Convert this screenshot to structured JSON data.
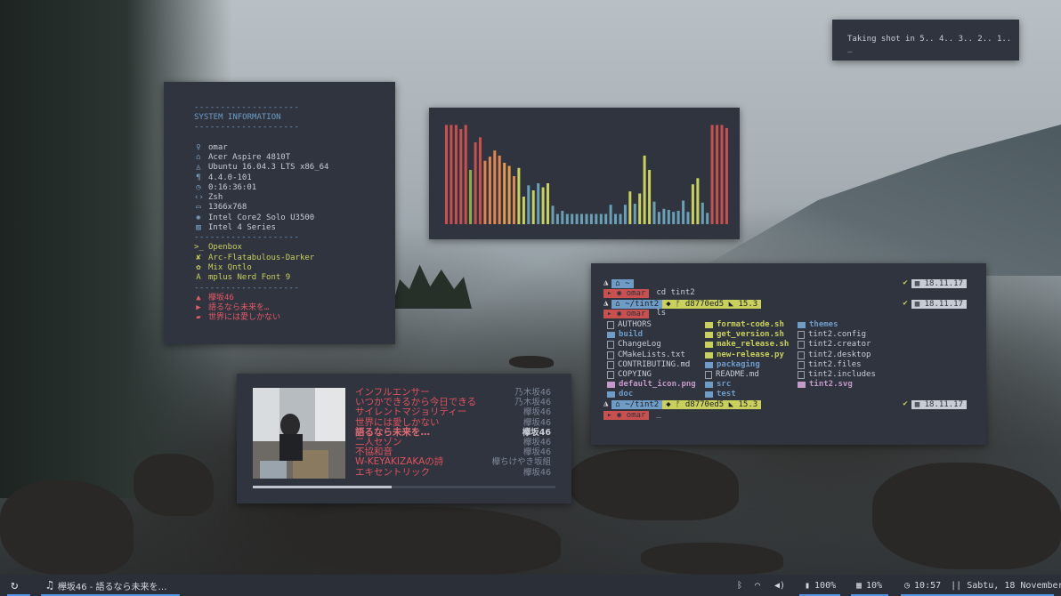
{
  "screenshot": {
    "countdown": "Taking shot in 5.. 4.. 3.. 2.. 1.. _"
  },
  "sysinfo": {
    "dash": "--------------------",
    "header": "SYSTEM INFORMATION",
    "rows": [
      {
        "icon": "user-icon",
        "glyph": "♀",
        "text": "omar"
      },
      {
        "icon": "machine-icon",
        "glyph": "⌂",
        "text": "Acer Aspire 4810T"
      },
      {
        "icon": "os-icon",
        "glyph": "◬",
        "text": "Ubuntu 16.04.3 LTS x86_64"
      },
      {
        "icon": "kernel-icon",
        "glyph": "¶",
        "text": "4.4.0-101"
      },
      {
        "icon": "uptime-icon",
        "glyph": "◷",
        "text": "0:16:36:01"
      },
      {
        "icon": "shell-icon",
        "glyph": "‹›",
        "text": "Zsh"
      },
      {
        "icon": "resolution-icon",
        "glyph": "▭",
        "text": "1366x768"
      },
      {
        "icon": "cpu-icon",
        "glyph": "✺",
        "text": "Intel Core2 Solo U3500"
      },
      {
        "icon": "gpu-icon",
        "glyph": "▨",
        "text": "Intel 4 Series"
      }
    ],
    "rows2": [
      {
        "icon": "wm-icon",
        "glyph": ">_",
        "text": "Openbox"
      },
      {
        "icon": "theme-icon",
        "glyph": "✘",
        "text": "Arc-Flatabulous-Darker"
      },
      {
        "icon": "icons-icon",
        "glyph": "✿",
        "text": "Mix Qntlo"
      },
      {
        "icon": "font-icon",
        "glyph": "A",
        "text": "mplus Nerd Font 9"
      }
    ],
    "rows3": [
      {
        "icon": "lock-icon",
        "glyph": "▲",
        "text": "欅坂46"
      },
      {
        "icon": "play-icon",
        "glyph": "▶",
        "text": "語るなら未来を…"
      },
      {
        "icon": "folder-icon",
        "glyph": "▰",
        "text": "世界には愛しかない"
      }
    ]
  },
  "visualizer": {
    "levels": [
      0.97,
      0.97,
      0.97,
      0.93,
      0.97,
      0.53,
      0.8,
      0.85,
      0.62,
      0.66,
      0.72,
      0.67,
      0.6,
      0.57,
      0.47,
      0.55,
      0.27,
      0.38,
      0.33,
      0.4,
      0.36,
      0.4,
      0.18,
      0.1,
      0.13,
      0.1,
      0.1,
      0.1,
      0.1,
      0.1,
      0.1,
      0.1,
      0.1,
      0.1,
      0.19,
      0.1,
      0.1,
      0.19,
      0.32,
      0.2,
      0.3,
      0.67,
      0.53,
      0.22,
      0.12,
      0.15,
      0.14,
      0.12,
      0.13,
      0.23,
      0.12,
      0.39,
      0.45,
      0.21,
      0.11,
      0.97,
      0.97,
      0.97,
      0.94
    ],
    "colors": [
      "#c9504f",
      "#c9504f",
      "#c9504f",
      "#c9504f",
      "#c9504f",
      "#8bb046",
      "#c9504f",
      "#c9504f",
      "#e0864e",
      "#e0864e",
      "#e0864e",
      "#e0864e",
      "#e39b52",
      "#e39b52",
      "#e0864e",
      "#c9d05c",
      "#c9d05c",
      "#6a9fb5",
      "#c9d05c",
      "#6a9fb5",
      "#c9d05c",
      "#c9d05c",
      "#6a9fb5",
      "#6a9fb5",
      "#6a9fb5",
      "#6a9fb5",
      "#6a9fb5",
      "#6a9fb5",
      "#6a9fb5",
      "#6a9fb5",
      "#6a9fb5",
      "#6a9fb5",
      "#6a9fb5",
      "#6a9fb5",
      "#6a9fb5",
      "#6a9fb5",
      "#6a9fb5",
      "#6a9fb5",
      "#c9d05c",
      "#6a9fb5",
      "#c9d05c",
      "#c9d05c",
      "#c9d05c",
      "#6a9fb5",
      "#6a9fb5",
      "#6a9fb5",
      "#6a9fb5",
      "#6a9fb5",
      "#6a9fb5",
      "#6a9fb5",
      "#6a9fb5",
      "#c9d05c",
      "#c9d05c",
      "#6a9fb5",
      "#6a9fb5",
      "#c9504f",
      "#c9504f",
      "#c9504f",
      "#c9504f"
    ]
  },
  "terminal": {
    "home_seg": "~",
    "user": "omar",
    "cmd1": "cd tint2",
    "dir": "~/tint2",
    "branch": "d8770ed5",
    "version": "15.3",
    "cmd2": "ls",
    "date": "18.11.17",
    "cursor": "_",
    "files_col1": [
      {
        "name": "AUTHORS",
        "type": "file"
      },
      {
        "name": "build",
        "type": "dir"
      },
      {
        "name": "ChangeLog",
        "type": "file"
      },
      {
        "name": "CMakeLists.txt",
        "type": "file"
      },
      {
        "name": "CONTRIBUTING.md",
        "type": "file"
      },
      {
        "name": "COPYING",
        "type": "file"
      },
      {
        "name": "default_icon.png",
        "type": "img"
      },
      {
        "name": "doc",
        "type": "dir"
      }
    ],
    "files_col2": [
      {
        "name": "format-code.sh",
        "type": "exec"
      },
      {
        "name": "get_version.sh",
        "type": "exec"
      },
      {
        "name": "make_release.sh",
        "type": "exec"
      },
      {
        "name": "new-release.py",
        "type": "exec"
      },
      {
        "name": "packaging",
        "type": "dir"
      },
      {
        "name": "README.md",
        "type": "file"
      },
      {
        "name": "src",
        "type": "dir"
      },
      {
        "name": "test",
        "type": "dir"
      }
    ],
    "files_col3": [
      {
        "name": "themes",
        "type": "dir"
      },
      {
        "name": "tint2.config",
        "type": "file"
      },
      {
        "name": "tint2.creator",
        "type": "file"
      },
      {
        "name": "tint2.desktop",
        "type": "file"
      },
      {
        "name": "tint2.files",
        "type": "file"
      },
      {
        "name": "tint2.includes",
        "type": "file"
      },
      {
        "name": "tint2.svg",
        "type": "img"
      }
    ]
  },
  "music": {
    "progress": 0.46,
    "tracks": [
      {
        "title": "インフルエンサー",
        "artist": "乃木坂46"
      },
      {
        "title": "いつかできるから今日できる",
        "artist": "乃木坂46"
      },
      {
        "title": "サイレントマジョリティー",
        "artist": "欅坂46"
      },
      {
        "title": "世界には愛しかない",
        "artist": "欅坂46"
      },
      {
        "title": "語るなら未来を…",
        "artist": "欅坂46",
        "current": true
      },
      {
        "title": "二人セゾン",
        "artist": "欅坂46"
      },
      {
        "title": "不協和音",
        "artist": "欅坂46"
      },
      {
        "title": "W-KEYAKIZAKAの詩",
        "artist": "欅ちけやき坂組"
      },
      {
        "title": "エキセントリック",
        "artist": "欅坂46"
      }
    ]
  },
  "taskbar": {
    "now_playing": "欅坂46 - 語るなら未来を…",
    "volume": "100%",
    "memory": "10%",
    "time": "10:57",
    "date": "|| Sabtu, 18 November"
  },
  "colors": {
    "panel": "#2f343f",
    "accent_blue": "#5294e2",
    "red": "#e0525e",
    "yellow_green": "#c9d05c"
  }
}
